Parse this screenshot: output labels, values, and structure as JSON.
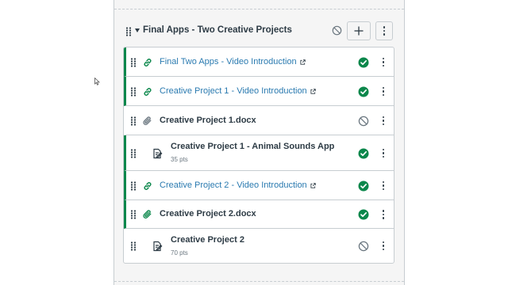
{
  "module": {
    "title": "Final Apps - Two Creative Projects",
    "icons": {
      "drag": "drag-handle-icon",
      "collapse": "caret-down-icon",
      "unpublished": "ban-icon",
      "add": "plus-icon",
      "menu": "kebab-icon"
    }
  },
  "items": [
    {
      "title": "Final Two Apps - Video Introduction",
      "type": "link-icon",
      "style": "link",
      "external": true,
      "points": "",
      "status": "published"
    },
    {
      "title": "Creative Project 1 - Video Introduction",
      "type": "link-icon",
      "style": "link",
      "external": true,
      "points": "",
      "status": "published"
    },
    {
      "title": "Creative Project 1.docx",
      "type": "paperclip-icon",
      "style": "bold",
      "external": false,
      "points": "",
      "status": "unpublished"
    },
    {
      "title": "Creative Project 1 - Animal Sounds App",
      "type": "assignment-icon",
      "style": "bold",
      "external": false,
      "points": "35 pts",
      "status": "published"
    },
    {
      "title": "Creative Project 2 - Video Introduction",
      "type": "link-icon",
      "style": "link",
      "external": true,
      "points": "",
      "status": "published"
    },
    {
      "title": "Creative Project 2.docx",
      "type": "paperclip-icon",
      "style": "bold",
      "external": false,
      "points": "",
      "status": "published"
    },
    {
      "title": "Creative Project 2",
      "type": "assignment-icon",
      "style": "bold",
      "external": false,
      "points": "70 pts",
      "status": "unpublished"
    }
  ],
  "colors": {
    "published": "#0b874b",
    "link": "#2a7ab0",
    "text": "#2d3b45",
    "border": "#c7cdd1",
    "unpublished": "#6b7780"
  }
}
